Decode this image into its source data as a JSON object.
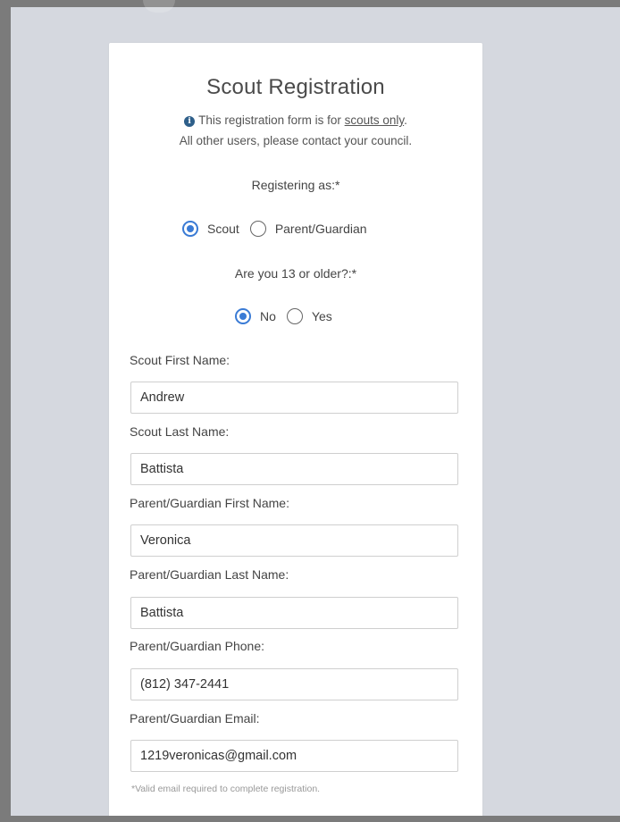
{
  "form": {
    "title": "Scout Registration",
    "notice_line1_prefix": "This registration form is for ",
    "notice_line1_link": "scouts only",
    "notice_line1_suffix": ".",
    "notice_line2": "All other users, please contact your council.",
    "info_icon": "info-icon",
    "registering_as": {
      "label": "Registering as:*",
      "options": [
        "Scout",
        "Parent/Guardian"
      ],
      "selected": "Scout"
    },
    "age_question": {
      "label": "Are you 13 or older?:*",
      "options": [
        "No",
        "Yes"
      ],
      "selected": "No"
    },
    "fields": {
      "scout_first_name": {
        "label": "Scout First Name:",
        "value": "Andrew"
      },
      "scout_last_name": {
        "label": "Scout Last Name:",
        "value": "Battista"
      },
      "parent_first_name": {
        "label": "Parent/Guardian First Name:",
        "value": "Veronica"
      },
      "parent_last_name": {
        "label": "Parent/Guardian Last Name:",
        "value": "Battista"
      },
      "parent_phone": {
        "label": "Parent/Guardian Phone:",
        "value": "(812) 347-2441"
      },
      "parent_email": {
        "label": "Parent/Guardian Email:",
        "value": "1219veronicas@gmail.com"
      }
    },
    "email_hint": "*Valid email required to complete registration.",
    "accent_color": "#3a7bd5"
  }
}
